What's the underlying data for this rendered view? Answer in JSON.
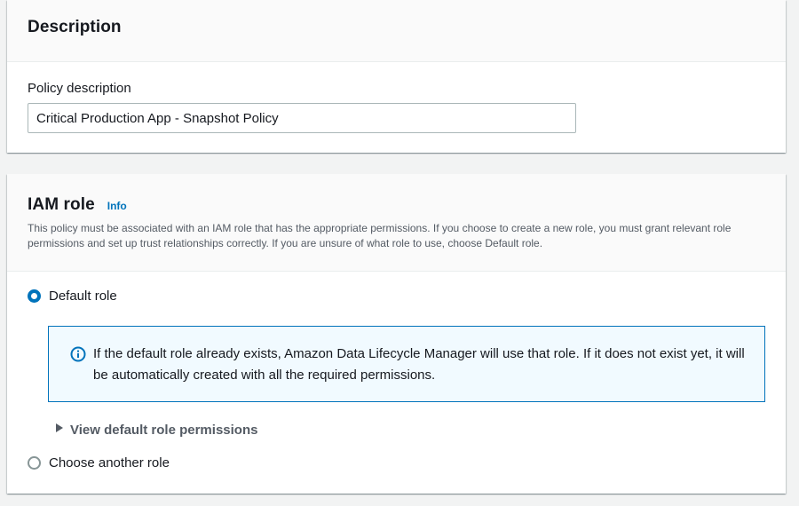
{
  "description_card": {
    "title": "Description",
    "field_label": "Policy description",
    "field_value": "Critical Production App - Snapshot Policy"
  },
  "iam_card": {
    "title": "IAM role",
    "info_link": "Info",
    "description": "This policy must be associated with an IAM role that has the appropriate permissions. If you choose to create a new role, you must grant relevant role permissions and set up trust relationships correctly. If you are unsure of what role to use, choose Default role.",
    "options": [
      {
        "label": "Default role",
        "selected": true
      },
      {
        "label": "Choose another role",
        "selected": false
      }
    ],
    "alert_text": "If the default role already exists, Amazon Data Lifecycle Manager will use that role. If it does not exist yet, it will be automatically created with all the required permissions.",
    "expander_label": "View default role permissions"
  },
  "colors": {
    "accent": "#0073bb",
    "alert_bg": "#f1faff",
    "secondary_text": "#545b64"
  },
  "icons": [
    "info-circle-icon",
    "caret-right-icon"
  ]
}
